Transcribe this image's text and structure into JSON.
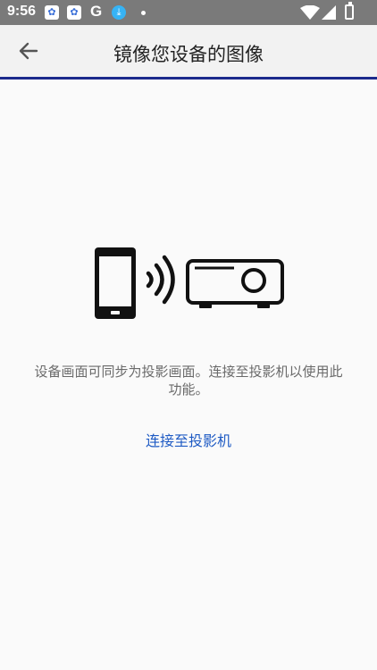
{
  "status_bar": {
    "time": "9:56",
    "notification_icons": [
      "baidu-icon",
      "baidu-icon",
      "google-icon",
      "download-icon",
      "dot-icon"
    ],
    "system_icons": [
      "wifi-icon",
      "cellular-icon",
      "battery-icon"
    ],
    "google_glyph": "G"
  },
  "app_bar": {
    "title": "镜像您设备的图像",
    "back_icon": "arrow-back-icon",
    "accent_color": "#1b2a8c"
  },
  "main": {
    "illustration_icons": [
      "phone-icon",
      "wireless-signal-icon",
      "projector-icon"
    ],
    "description": "设备画面可同步为投影画面。连接至投影机以使用此功能。",
    "connect_link": "连接至投影机",
    "link_color": "#1f5bc4"
  }
}
